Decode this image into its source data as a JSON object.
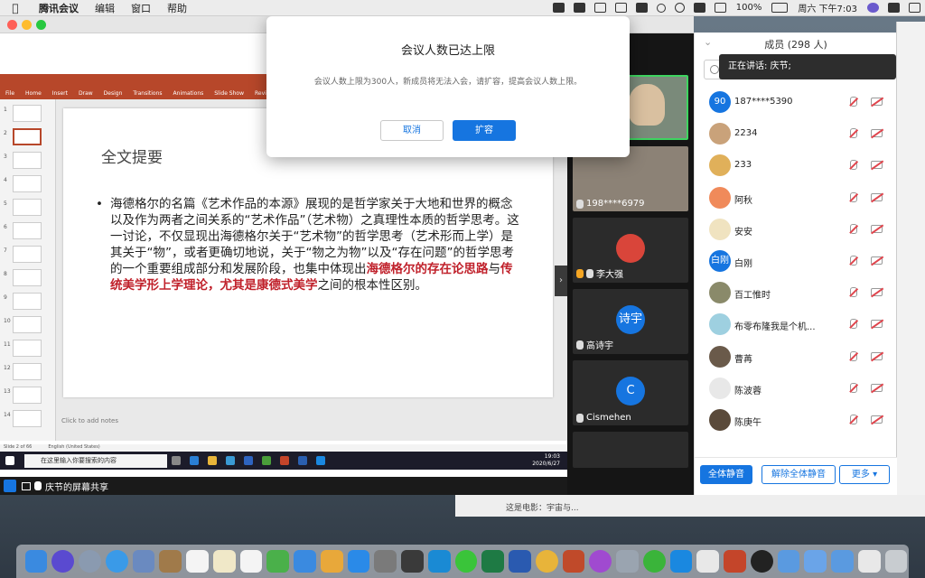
{
  "menubar": {
    "app": "腾讯会议",
    "menus": [
      "编辑",
      "窗口",
      "帮助"
    ],
    "battery": "100%",
    "datetime": "周六 下午7:03"
  },
  "dialog": {
    "title": "会议人数已达上限",
    "message": "会议人数上限为300人，新成员将无法入会，请扩容，提高会议人数上限。",
    "cancel_label": "取消",
    "confirm_label": "扩容"
  },
  "ppt": {
    "ribbon_tabs": [
      "File",
      "Home",
      "Insert",
      "Draw",
      "Design",
      "Transitions",
      "Animations",
      "Slide Show",
      "Review"
    ],
    "slide_numbers": [
      "1",
      "2",
      "3",
      "4",
      "5",
      "6",
      "7",
      "8",
      "9",
      "10",
      "11",
      "12",
      "13",
      "14"
    ],
    "slide_title": "全文提要",
    "body_part1": "海德格尔的名篇《艺术作品的本源》展现的是哲学家关于大地和世界的概念以及作为两者之间关系的“艺术作品”（艺术物）之真理性本质的哲学思考。这一讨论，不仅显现出海德格尔关于“艺术物”的哲学思考（艺术形而上学）是其关于“物”，或者更确切地说，关于“物之为物”以及“存在问题”的哲学思考的一个重要组成部分和发展阶段，也集中体现出",
    "body_red1": "海德格尔的存在论思路",
    "body_mid": "与",
    "body_red2": "传统美学形上学理论，尤其是康德式美学",
    "body_end": "之间的根本性区别。",
    "notes": "Click to add notes",
    "status_left": "Slide 2 of 66",
    "status_lang": "English (United States)",
    "taskbar_search": "在这里输入你要搜索的内容",
    "taskbar_time": "19:03",
    "taskbar_date": "2020/6/27"
  },
  "share_bar": {
    "label": "庆节的屏幕共享"
  },
  "video_tiles": [
    {
      "name": "",
      "avatar": ""
    },
    {
      "name": "198****6979",
      "avatar": ""
    },
    {
      "name": "李大强",
      "avatar": ""
    },
    {
      "name": "高诗宇",
      "avatar": "诗宇"
    },
    {
      "name": "Cismehen",
      "avatar": "C"
    }
  ],
  "members": {
    "title": "成员 (298 人)",
    "speaking_tooltip": "正在讲话: 庆节;",
    "list": [
      {
        "name": "187****5390",
        "avatar": "90",
        "color": "#1675e0"
      },
      {
        "name": "2234",
        "avatar": "",
        "color": "#c9a27a"
      },
      {
        "name": "233",
        "avatar": "",
        "color": "#e0b05a"
      },
      {
        "name": "阿秋",
        "avatar": "",
        "color": "#f08a5a"
      },
      {
        "name": "安安",
        "avatar": "",
        "color": "#f0e3c0"
      },
      {
        "name": "白刚",
        "avatar": "白刚",
        "color": "#1675e0"
      },
      {
        "name": "百工惟时",
        "avatar": "",
        "color": "#8a8a6a"
      },
      {
        "name": "布零布隆我是个机...",
        "avatar": "",
        "color": "#9ed0e0"
      },
      {
        "name": "曹苒",
        "avatar": "",
        "color": "#6a5a4a"
      },
      {
        "name": "陈波蓉",
        "avatar": "",
        "color": "#e8e8e8"
      },
      {
        "name": "陈庚午",
        "avatar": "",
        "color": "#5a4a3a"
      }
    ],
    "mute_all": "全体静音",
    "unmute_all": "解除全体静音",
    "more": "更多 ▾"
  },
  "background_window": {
    "text": "这是电影：宇宙与..."
  },
  "colors": {
    "accent": "#1675e0",
    "ppt": "#b7472a",
    "danger": "#c0212b"
  }
}
